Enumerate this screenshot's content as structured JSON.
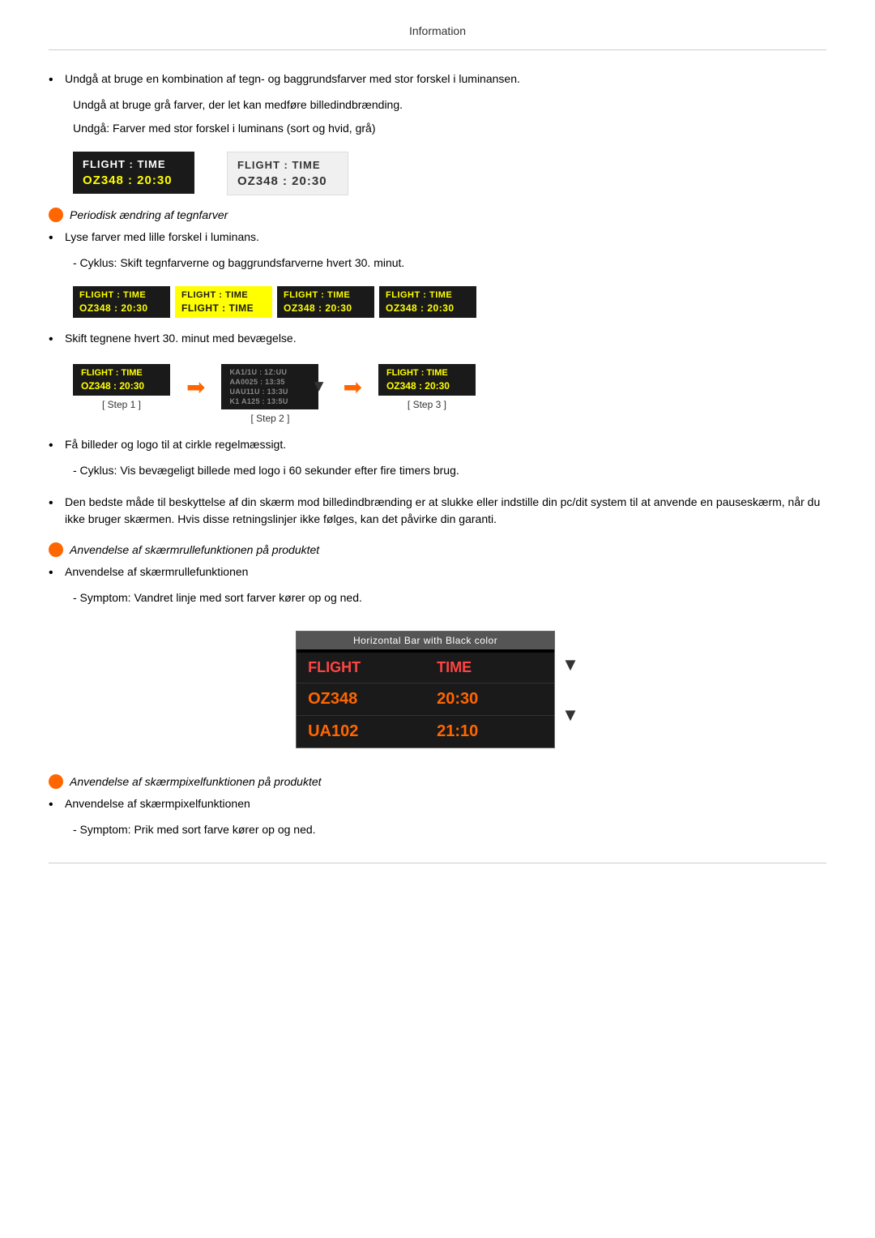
{
  "header": {
    "title": "Information"
  },
  "content": {
    "bullet1": "Undgå at bruge en kombination af tegn- og baggrundsfarver med stor forskel i luminansen.",
    "indent1": "Undgå at bruge grå farver, der let kan medføre billedindbrænding.",
    "indent2": "Undgå: Farver med stor forskel i luminans (sort og hvid, grå)",
    "flight_demo_dark_header": "FLIGHT  :  TIME",
    "flight_demo_dark_data": "OZ348   :  20:30",
    "flight_demo_light_header": "FLIGHT  :  TIME",
    "flight_demo_light_data": "OZ348   :  20:30",
    "orange_label1": "Periodisk ændring af tegnfarver",
    "bullet2": "Lyse farver med lille forskel i luminans.",
    "indent3": "- Cyklus: Skift tegnfarverne og baggrundsfarverne hvert 30. minut.",
    "cycle_boxes": [
      {
        "header": "FLIGHT  :  TIME",
        "data": "OZ348   :  20:30"
      },
      {
        "header": "FLIGHT  :  TIME",
        "data": "FLIGHT  :  TIME"
      },
      {
        "header": "FLIGHT  :  TIME",
        "data": "OZ348   :  20:30"
      },
      {
        "header": "FLIGHT  :  TIME",
        "data": "OZ348   :  20:30"
      }
    ],
    "bullet3": "Skift tegnene hvert 30. minut med bevægelse.",
    "step1_header": "FLIGHT  :  TIME",
    "step1_data": "OZ348   :  20:30",
    "step1_label": "[ Step 1 ]",
    "step2_label": "[ Step 2 ]",
    "step3_header": "FLIGHT  :  TIME",
    "step3_data": "OZ348   :  20:30",
    "step3_label": "[ Step 3 ]",
    "bullet4": "Få billeder og logo til at cirkle regelmæssigt.",
    "indent4": "- Cyklus: Vis bevægeligt billede med logo i 60 sekunder efter fire timers brug.",
    "bullet5": "Den bedste måde til beskyttelse af din skærm mod billedindbrænding er at slukke eller indstille din pc/dit system til at anvende en pauseskærm, når du ikke bruger skærmen. Hvis disse retningslinjer ikke følges, kan det påvirke din garanti.",
    "orange_label2": "Anvendelse af skærmrullefunktionen på produktet",
    "bullet6": "Anvendelse af skærmrullefunktionen",
    "indent5": "- Symptom: Vandret linje med sort farver kører op og ned.",
    "scrollbar_header": "Horizontal Bar with Black color",
    "flight_label": "FLIGHT",
    "time_label": "TIME",
    "oz_label": "OZ348",
    "t2030_label": "20:30",
    "ua_label": "UA102",
    "t2110_label": "21:10",
    "orange_label3": "Anvendelse af skærmpixelfunktionen på produktet",
    "bullet7": "Anvendelse af skærmpixelfunktionen",
    "indent6": "- Symptom: Prik med sort farve kører op og ned."
  }
}
